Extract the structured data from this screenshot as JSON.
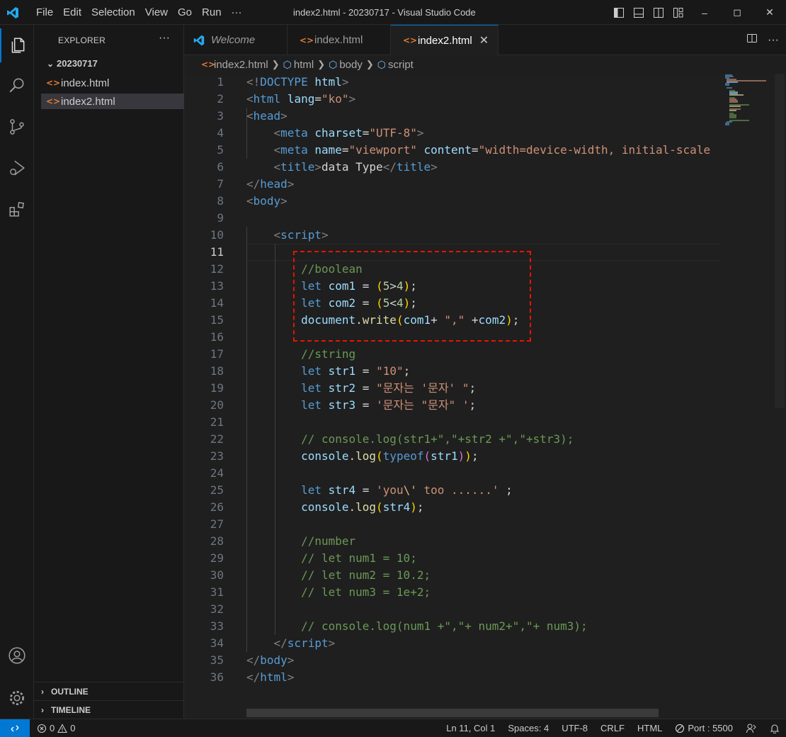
{
  "titlebar": {
    "menu": [
      "File",
      "Edit",
      "Selection",
      "View",
      "Go",
      "Run",
      "···"
    ],
    "title": "index2.html - 20230717 - Visual Studio Code"
  },
  "sidebar": {
    "header": "EXPLORER",
    "more": "···",
    "folder": "20230717",
    "files": [
      "index.html",
      "index2.html"
    ],
    "outline": "OUTLINE",
    "timeline": "TIMELINE"
  },
  "tabs": [
    {
      "label": "Welcome",
      "italic": true
    },
    {
      "label": "index.html"
    },
    {
      "label": "index2.html",
      "active": true
    }
  ],
  "breadcrumb": [
    "index2.html",
    "html",
    "body",
    "script"
  ],
  "editor": {
    "line_numbers": [
      "1",
      "2",
      "3",
      "4",
      "5",
      "6",
      "7",
      "8",
      "9",
      "10",
      "11",
      "12",
      "13",
      "14",
      "15",
      "16",
      "17",
      "18",
      "19",
      "20",
      "21",
      "22",
      "23",
      "24",
      "25",
      "26",
      "27",
      "28",
      "29",
      "30",
      "31",
      "32",
      "33",
      "34",
      "35",
      "36"
    ],
    "current_line": "11"
  },
  "statusbar": {
    "errors": "0",
    "warnings": "0",
    "position": "Ln 11, Col 1",
    "spaces": "Spaces: 4",
    "encoding": "UTF-8",
    "eol": "CRLF",
    "language": "HTML",
    "port": "Port : 5500"
  },
  "colors": {
    "accent": "#0078d4",
    "highlight_box": "#e51400"
  }
}
